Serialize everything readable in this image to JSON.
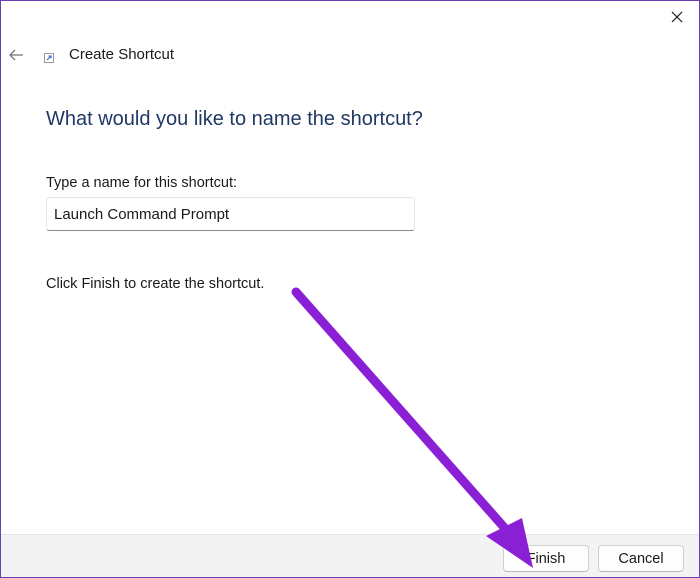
{
  "dialog": {
    "title": "Create Shortcut",
    "heading": "What would you like to name the shortcut?",
    "field_label": "Type a name for this shortcut:",
    "name_value": "Launch Command Prompt",
    "hint": "Click Finish to create the shortcut."
  },
  "buttons": {
    "finish_label": "Finish",
    "cancel_label": "Cancel"
  },
  "icons": {
    "close": "close-icon",
    "back": "back-arrow-icon",
    "shortcut": "shortcut-icon"
  },
  "colors": {
    "heading": "#1f3864",
    "window_border": "#6a3fb0",
    "annotation_arrow": "#8a1fd6",
    "footer_bg": "#f3f3f3"
  }
}
